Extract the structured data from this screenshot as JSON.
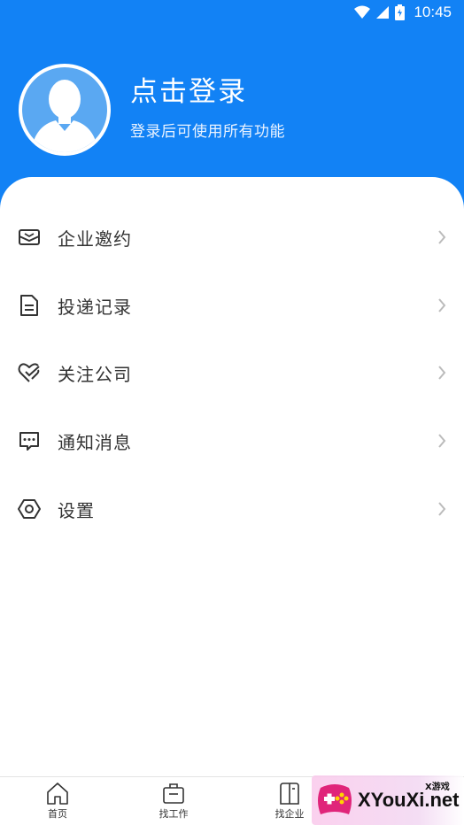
{
  "status": {
    "time": "10:45"
  },
  "profile": {
    "title": "点击登录",
    "subtitle": "登录后可使用所有功能"
  },
  "menu": [
    {
      "label": "企业邀约",
      "icon": "mail-icon"
    },
    {
      "label": "投递记录",
      "icon": "document-icon"
    },
    {
      "label": "关注公司",
      "icon": "heart-check-icon"
    },
    {
      "label": "通知消息",
      "icon": "message-icon"
    },
    {
      "label": "设置",
      "icon": "settings-icon"
    }
  ],
  "nav": [
    {
      "label": "首页",
      "icon": "home-icon"
    },
    {
      "label": "找工作",
      "icon": "briefcase-icon"
    },
    {
      "label": "找企业",
      "icon": "building-icon"
    }
  ],
  "watermark": {
    "text": "XYouXi.net",
    "small": "X游戏"
  },
  "colors": {
    "brand": "#1282f5",
    "text": "#333333",
    "chevron": "#bbbbbb"
  }
}
